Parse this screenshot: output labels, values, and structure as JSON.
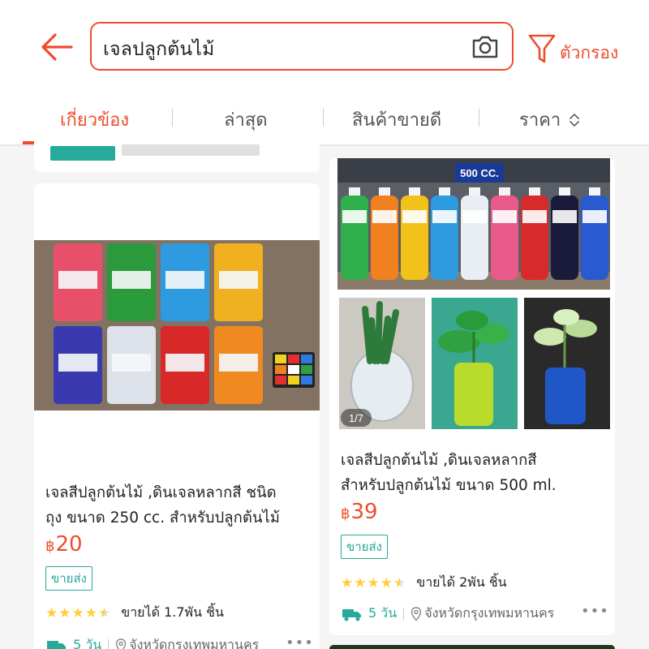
{
  "search": {
    "query": "เจลปลูกต้นไม้"
  },
  "filter": {
    "label": "ตัวกรอง"
  },
  "tabs": [
    {
      "label": "เกี่ยวข้อง",
      "active": true
    },
    {
      "label": "ล่าสุด",
      "active": false
    },
    {
      "label": "สินค้าขายดี",
      "active": false
    },
    {
      "label": "ราคา",
      "active": false
    }
  ],
  "products": [
    {
      "title_line1": "เจลสีปลูกต้นไม้ ,ดินเจลหลากสี ชนิด",
      "title_line2": "ถุง ขนาด 250 cc. สำหรับปลูกต้นไม้",
      "currency": "฿",
      "price": "20",
      "tag": "ขายส่ง",
      "rating_stars": 4.5,
      "sold": "ขายได้ 1.7พัน ชิ้น",
      "ship_days": "5 วัน",
      "location": "จังหวัดกรุงเทพมหานคร",
      "image_bag_colors": [
        "#e8506a",
        "#2a9a3a",
        "#2e9be0",
        "#f0b020",
        "#3a3ab0",
        "#dde2ea",
        "#d82828",
        "#f08a20"
      ]
    },
    {
      "title_line1": "เจลสีปลูกต้นไม้ ,ดินเจลหลากสี",
      "title_line2": "สำหรับปลูกต้นไม้ ขนาด 500 ml.",
      "currency": "฿",
      "price": "39",
      "tag": "ขายส่ง",
      "rating_stars": 4.5,
      "sold": "ขายได้ 2พัน ชิ้น",
      "ship_days": "5 วัน",
      "location": "จังหวัดกรุงเทพมหานคร",
      "image_caption": "500 CC.",
      "image_counter": "1/7",
      "image_bottle_colors": [
        "#2fb04a",
        "#f08020",
        "#f2c21a",
        "#2e9be0",
        "#e8eef4",
        "#e85a8a",
        "#d82a2a",
        "#1a1a3a",
        "#2a5ad0"
      ]
    }
  ],
  "colors": {
    "accent": "#ee4d2d",
    "teal": "#26aa99",
    "star": "#ffce3d"
  }
}
